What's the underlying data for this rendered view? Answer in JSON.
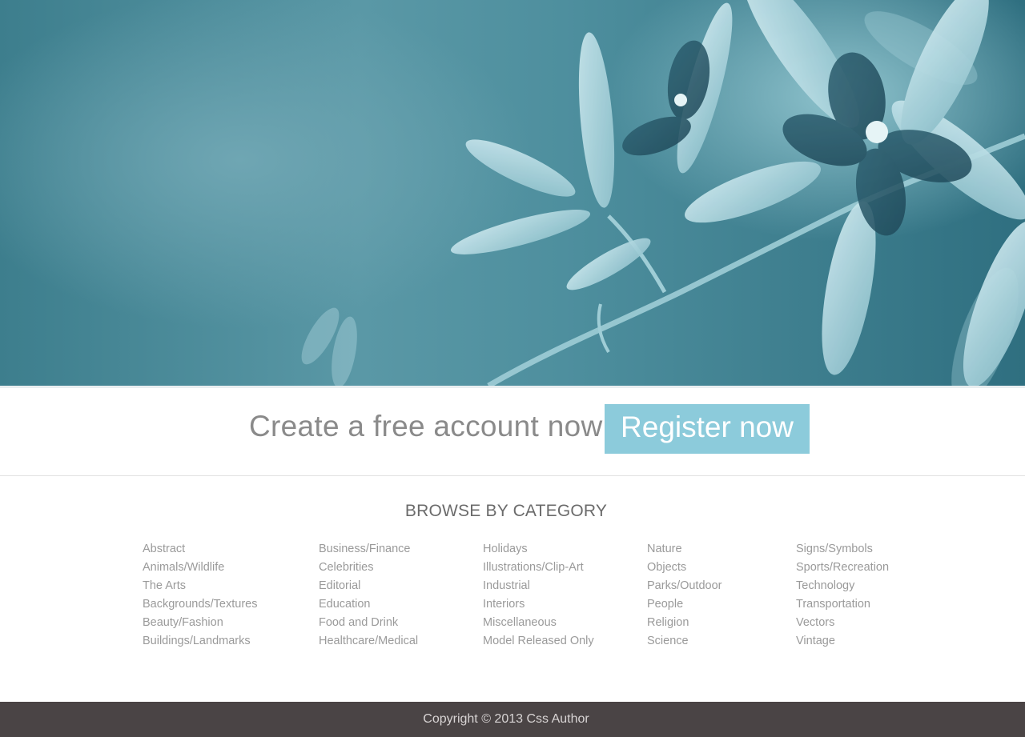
{
  "hero": {
    "image_desc": "flower-photo",
    "accent": "#4e8f9e"
  },
  "cta": {
    "text": "Create a free account now",
    "button_label": "Register now",
    "button_color": "#8ccbdb"
  },
  "browse": {
    "title": "BROWSE BY CATEGORY",
    "columns": [
      [
        "Abstract",
        "Animals/Wildlife",
        "The Arts",
        "Backgrounds/Textures",
        "Beauty/Fashion",
        "Buildings/Landmarks"
      ],
      [
        "Business/Finance",
        "Celebrities",
        "Editorial",
        "Education",
        "Food and Drink",
        "Healthcare/Medical"
      ],
      [
        "Holidays",
        "Illustrations/Clip-Art",
        "Industrial",
        "Interiors",
        "Miscellaneous",
        "Model Released Only"
      ],
      [
        "Nature",
        "Objects",
        "Parks/Outdoor",
        "People",
        "Religion",
        "Science"
      ],
      [
        "Signs/Symbols",
        "Sports/Recreation",
        "Technology",
        "Transportation",
        "Vectors",
        "Vintage"
      ]
    ]
  },
  "footer": {
    "copyright": "Copyright © 2013 Css Author",
    "bg_color": "#4a4445"
  }
}
